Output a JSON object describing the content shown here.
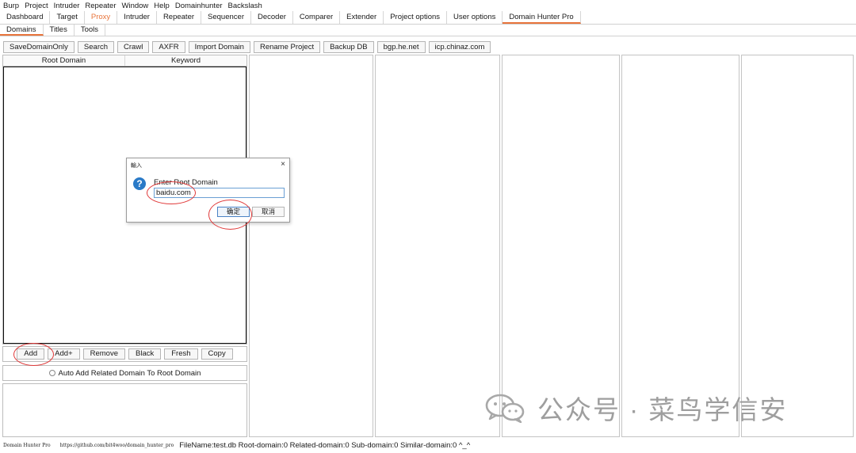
{
  "menu": [
    "Burp",
    "Project",
    "Intruder",
    "Repeater",
    "Window",
    "Help",
    "Domainhunter",
    "Backslash"
  ],
  "main_tabs": [
    "Dashboard",
    "Target",
    "Proxy",
    "Intruder",
    "Repeater",
    "Sequencer",
    "Decoder",
    "Comparer",
    "Extender",
    "Project options",
    "User options",
    "Domain Hunter Pro"
  ],
  "sub_tabs": [
    "Domains",
    "Titles",
    "Tools"
  ],
  "toolbar": [
    "SaveDomainOnly",
    "Search",
    "Crawl",
    "AXFR",
    "Import Domain",
    "Rename Project",
    "Backup DB",
    "bgp.he.net",
    "icp.chinaz.com"
  ],
  "table": {
    "columns": [
      "Root Domain",
      "Keyword"
    ]
  },
  "buttons": [
    "Add",
    "Add+",
    "Remove",
    "Black",
    "Fresh",
    "Copy"
  ],
  "auto_add_label": "Auto Add Related Domain To Root Domain",
  "dialog": {
    "title": "輸入",
    "close": "×",
    "label": "Enter Root Domain",
    "value": "baidu.com",
    "ok": "确定",
    "cancel": "取消",
    "icon": "question-icon"
  },
  "status": {
    "brand": "Domain Hunter Pro",
    "url": "https://github.com/bit4woo/domain_hunter_pro",
    "text": "FileName:test.db  Root-domain:0  Related-domain:0  Sub-domain:0  Similar-domain:0  ^_^"
  },
  "watermark": {
    "text": "公众号 · 菜鸟学信安",
    "icon": "wechat-icon"
  },
  "colors": {
    "accent": "#e8743b",
    "annotation": "#e03a3a",
    "dialog_icon": "#2a7ac7"
  }
}
